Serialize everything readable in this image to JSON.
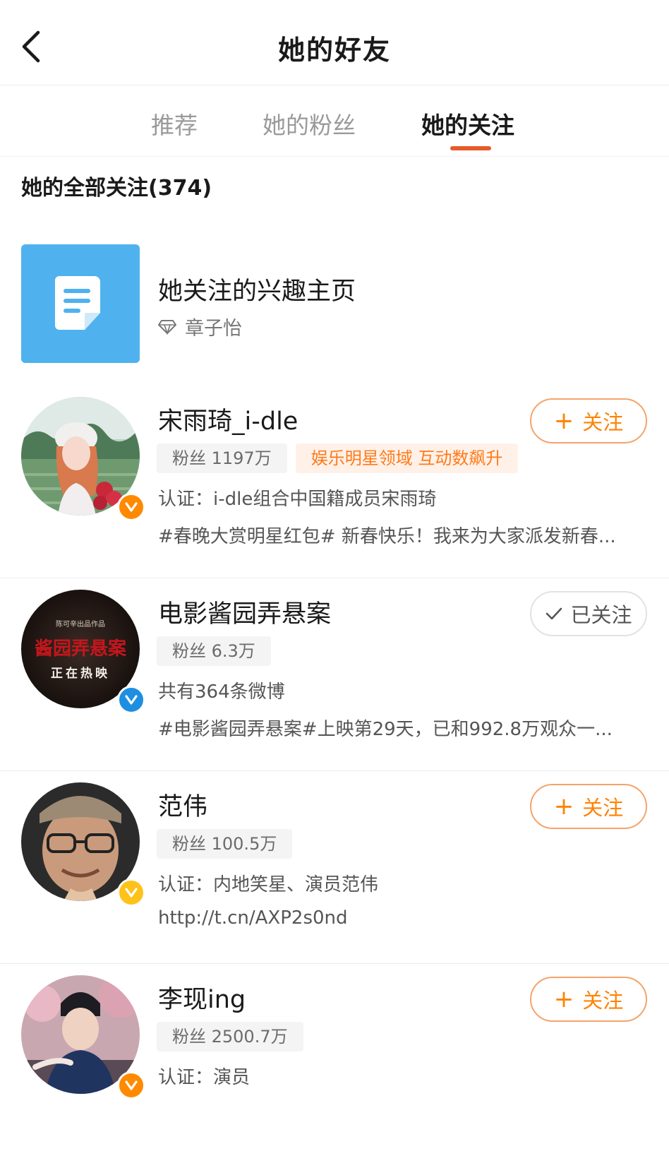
{
  "header": {
    "title": "她的好友",
    "back_icon": "chevron-left-icon"
  },
  "tabs": [
    {
      "label": "推荐",
      "active": false
    },
    {
      "label": "她的粉丝",
      "active": false
    },
    {
      "label": "她的关注",
      "active": true
    }
  ],
  "section_title": "她的全部关注(374)",
  "interest": {
    "title": "她关注的兴趣主页",
    "owner": "章子怡",
    "icon": "document-icon",
    "tile_color": "#4fb2ee"
  },
  "users": [
    {
      "name": "宋雨琦_i-dle",
      "fans": "粉丝 1197万",
      "tag": "娱乐明星领域 互动数飙升",
      "desc": "认证：i-dle组合中国籍成员宋雨琦",
      "post": "#春晚大赏明星红包# 新春快乐！我来为大家派发新春...",
      "follow_label": "关注",
      "followed": false,
      "badge": "orange"
    },
    {
      "name": "电影酱园弄悬案",
      "fans": "粉丝 6.3万",
      "desc": "共有364条微博",
      "post": "#电影酱园弄悬案#上映第29天，已和992.8万观众一...",
      "follow_label": "已关注",
      "followed": true,
      "badge": "blue",
      "avatar_text": {
        "title": "酱园弄悬案",
        "subtitle": "正在热映",
        "small": "陈可辛出品作品"
      }
    },
    {
      "name": "范伟",
      "fans": "粉丝 100.5万",
      "desc": "认证：内地笑星、演员范伟",
      "post": "http://t.cn/AXP2s0nd",
      "follow_label": "关注",
      "followed": false,
      "badge": "yellow"
    },
    {
      "name": "李现ing",
      "fans": "粉丝 2500.7万",
      "desc": "认证：演员",
      "follow_label": "关注",
      "followed": false,
      "badge": "orange"
    }
  ],
  "colors": {
    "accent": "#e85a2a",
    "follow_orange": "#ff8200",
    "badge_orange": "#ff8a00",
    "badge_yellow": "#ffc21a",
    "badge_blue": "#1e8fe0"
  }
}
